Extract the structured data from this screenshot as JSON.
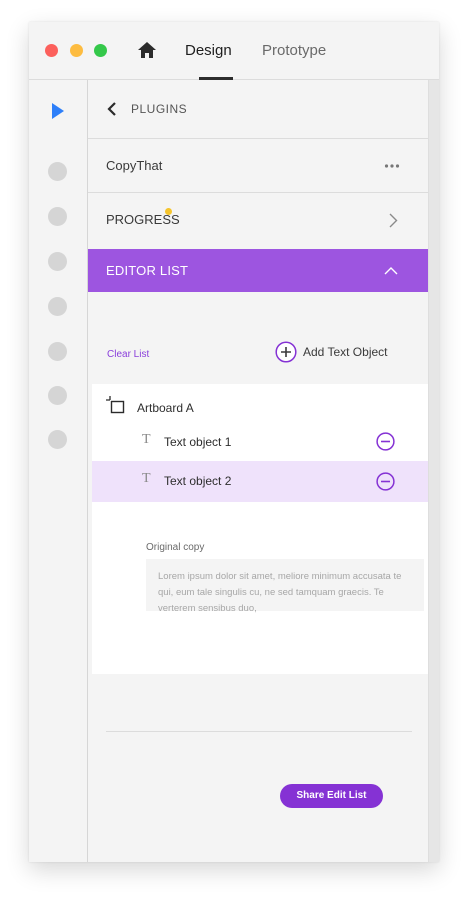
{
  "colors": {
    "accent": "#9d55e0",
    "accent_dark": "#8532d4",
    "link": "#8a3fdb",
    "selected_row": "#efe2fb",
    "traffic_red": "#fc605c",
    "traffic_yellow": "#fdbc40",
    "traffic_green": "#34c84a",
    "select_tool": "#2d7ff9",
    "progress_dot": "#f5c42c"
  },
  "titlebar": {
    "home_icon": "home-icon",
    "tabs": [
      {
        "label": "Design",
        "active": true
      },
      {
        "label": "Prototype",
        "active": false
      }
    ]
  },
  "toolbar": {
    "select_icon": "cursor-arrow-icon",
    "tool_count": 7
  },
  "panel": {
    "back_icon": "chevron-left-icon",
    "header": "PLUGINS",
    "plugin_name": "CopyThat",
    "plugin_more_icon": "more-horizontal-icon",
    "progress_label": "PROGRESS",
    "progress_icon": "chevron-right-icon",
    "editor_list_label": "EDITOR LIST",
    "editor_list_icon": "chevron-up-icon",
    "clear_list": "Clear List",
    "add_text_object": "Add Text Object",
    "artboard": {
      "label": "Artboard A",
      "icon": "artboard-icon",
      "items": [
        {
          "label": "Text object 1",
          "icon": "text-icon",
          "selected": false
        },
        {
          "label": "Text object 2",
          "icon": "text-icon",
          "selected": true
        }
      ]
    },
    "original_copy_label": "Original copy",
    "original_copy_text": "Lorem ipsum dolor sit amet, meliore minimum accusata te qui, eum tale singulis cu, ne sed tamquam graecis. Te verterem sensibus duo,",
    "share_button": "Share Edit List"
  }
}
